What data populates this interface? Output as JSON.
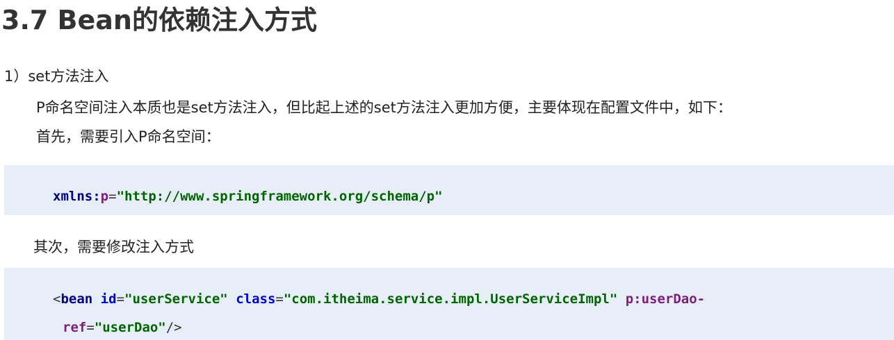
{
  "document": {
    "title": "3.7 Bean的依赖注入方式",
    "section": "1）set方法注入",
    "paragraphs": [
      "P命名空间注入本质也是set方法注入，但比起上述的set方法注入更加方便，主要体现在配置文件中，如下：",
      "首先，需要引入P命名空间：",
      "其次，需要修改注入方式"
    ]
  },
  "code1": {
    "ns_prefix": "xmlns",
    "colon": ":",
    "ns_name": "p",
    "eq": "=",
    "value": "\"http://www.springframework.org/schema/p\""
  },
  "code2": {
    "open": "<",
    "tag": "bean",
    "id_attr": "id",
    "eq": "=",
    "id_value": "\"userService\"",
    "class_attr": "class",
    "class_value": "\"com.itheima.service.impl.UserServiceImpl\"",
    "p_attr": "p:userDao-",
    "p_attr_cont": "ref",
    "ref_value": "\"userDao\"",
    "close": "/>"
  }
}
